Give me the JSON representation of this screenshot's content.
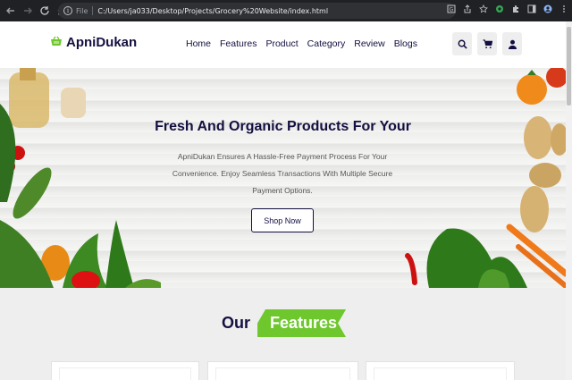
{
  "browser": {
    "file_label": "File",
    "url": "C:/Users/ja033/Desktop/Projects/Grocery%20Website/index.html",
    "icons": [
      "back-icon",
      "forward-icon",
      "reload-icon",
      "home-icon",
      "translate-icon",
      "share-icon",
      "star-icon",
      "extension-icon",
      "puzzle-icon",
      "sidebar-icon",
      "profile-icon",
      "menu-icon"
    ]
  },
  "header": {
    "logo": "ApniDukan",
    "nav": [
      "Home",
      "Features",
      "Product",
      "Category",
      "Review",
      "Blogs"
    ],
    "icons": [
      "search-icon",
      "cart-icon",
      "user-icon"
    ]
  },
  "hero": {
    "title": "Fresh And Organic Products For Your",
    "description": "ApniDukan Ensures A Hassle-Free Payment Process For Your Convenience. Enjoy Seamless Transactions With Multiple Secure Payment Options.",
    "button": "Shop Now"
  },
  "features": {
    "title_plain": "Our",
    "title_highlight": "Features"
  },
  "colors": {
    "brand_dark": "#130f40",
    "accent_green": "#6fc72e",
    "page_bg": "#eeeeee"
  }
}
